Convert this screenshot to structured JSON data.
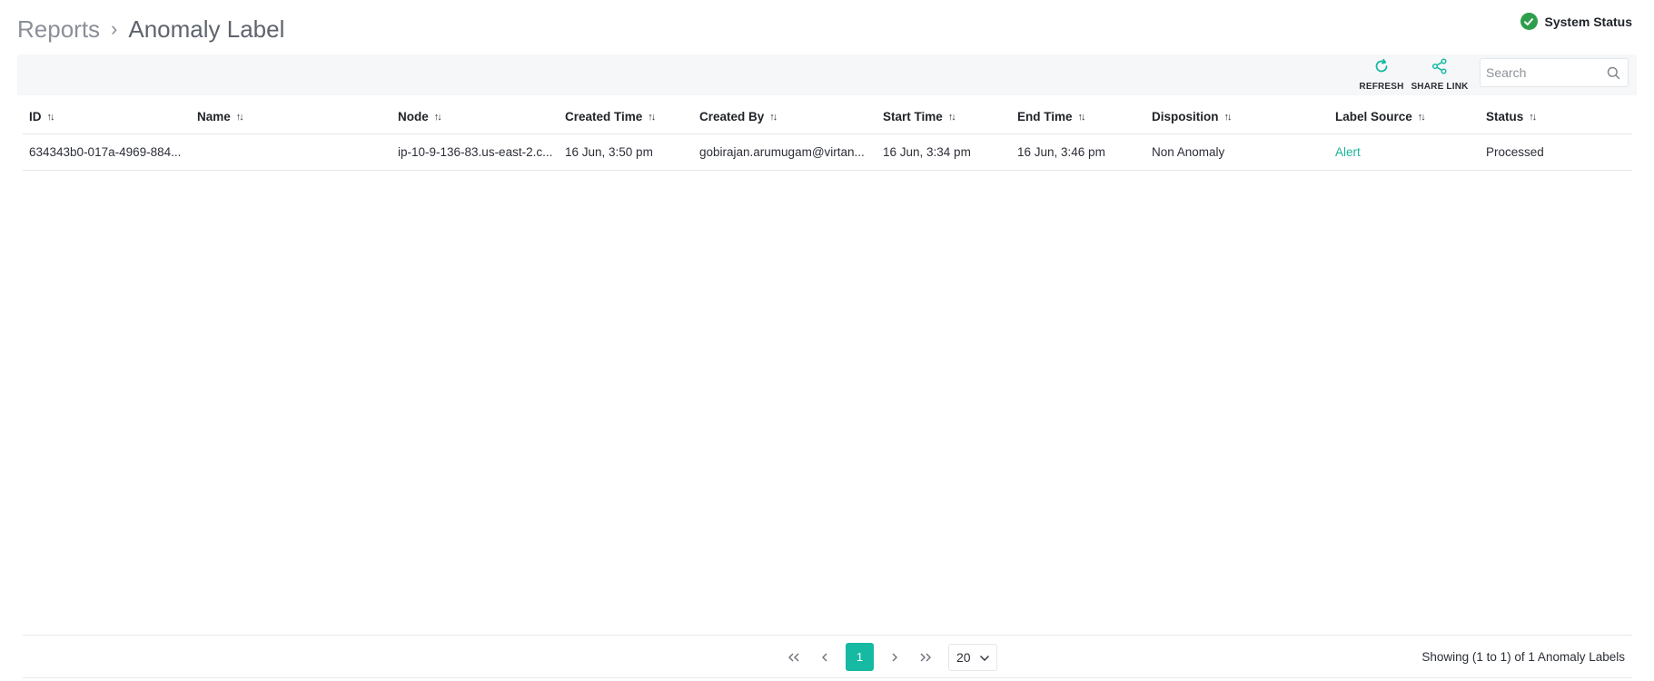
{
  "header": {
    "breadcrumb_parent": "Reports",
    "breadcrumb_separator": "›",
    "page_title": "Anomaly Label",
    "system_status_label": "System Status"
  },
  "toolbar": {
    "refresh_label": "REFRESH",
    "share_label": "SHARE LINK",
    "search_placeholder": "Search",
    "search_value": ""
  },
  "table": {
    "columns": [
      "ID",
      "Name",
      "Node",
      "Created Time",
      "Created By",
      "Start Time",
      "End Time",
      "Disposition",
      "Label Source",
      "Status"
    ],
    "rows": [
      {
        "id": "634343b0-017a-4969-884...",
        "name": "",
        "node": "ip-10-9-136-83.us-east-2.c...",
        "created_time": "16 Jun, 3:50 pm",
        "created_by": "gobirajan.arumugam@virtan...",
        "start_time": "16 Jun, 3:34 pm",
        "end_time": "16 Jun, 3:46 pm",
        "disposition": "Non Anomaly",
        "label_source": "Alert",
        "status": "Processed"
      }
    ]
  },
  "pagination": {
    "first": "«",
    "prev": "‹",
    "current_page": "1",
    "next": "›",
    "last": "»",
    "page_size": "20",
    "summary": "Showing (1 to 1) of 1 Anomaly Labels"
  },
  "colors": {
    "accent": "#16b9a2",
    "status_ok": "#2e9e4a",
    "link": "#19b39b"
  },
  "icons": {
    "refresh": "refresh-icon",
    "share": "share-icon",
    "search": "search-icon",
    "status": "check-circle-icon",
    "sort": "sort-icon",
    "dropdown": "chevron-down-icon"
  }
}
